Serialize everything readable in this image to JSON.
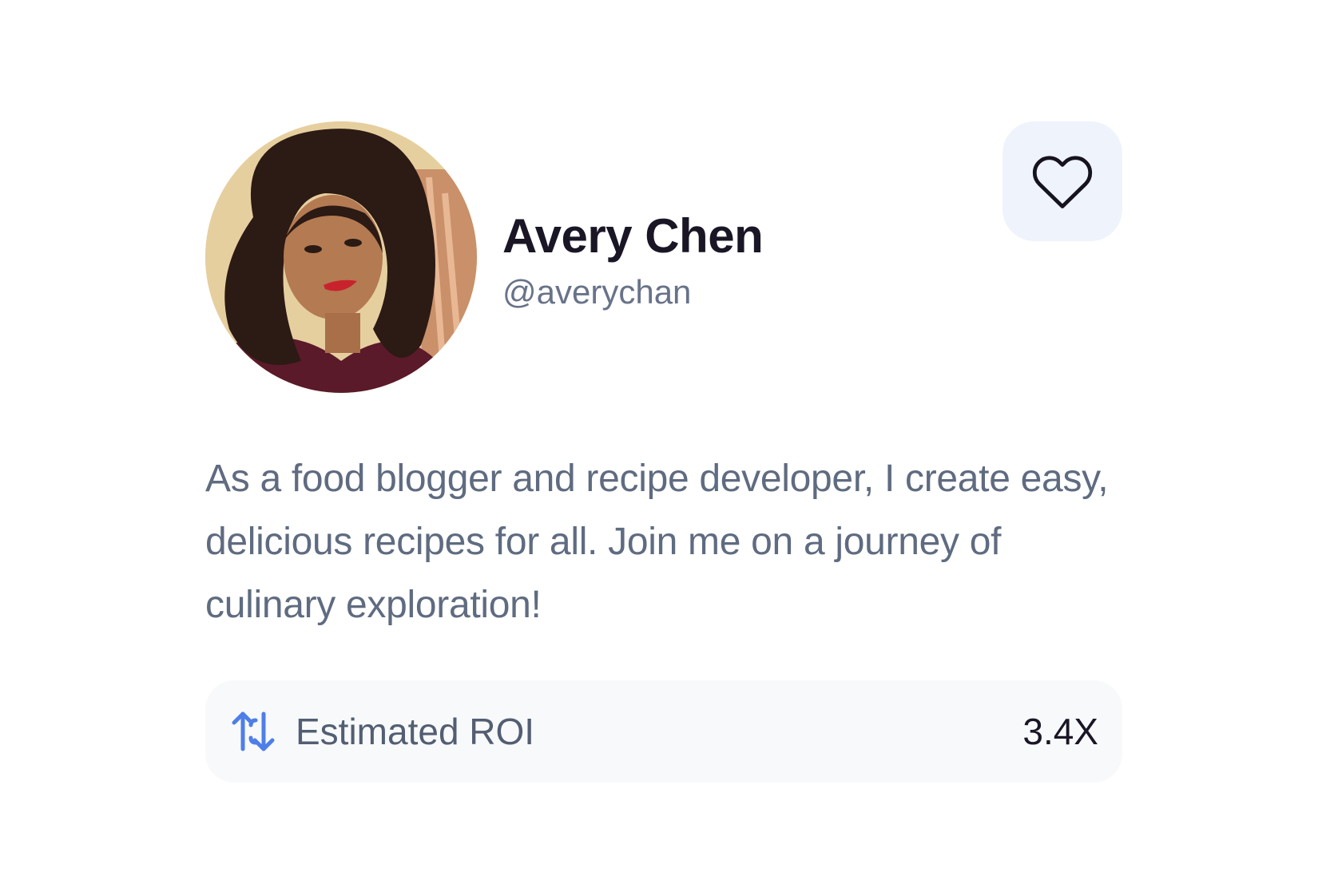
{
  "profile": {
    "name": "Avery Chen",
    "handle": "@averychan",
    "avatar": "portrait-photo",
    "bio": "As a food blogger and recipe developer, I create easy, delicious recipes for all. Join me on a journey of culinary exploration!"
  },
  "favorite": {
    "icon": "heart-outline-icon"
  },
  "stats": {
    "roi_label": "Estimated ROI",
    "roi_value": "3.4X",
    "roi_icon": "repeat-arrows-icon"
  },
  "colors": {
    "name": "#1a1626",
    "handle": "#687389",
    "bio": "#5f6b80",
    "favorite_bg": "#eef3fc",
    "roi_bg": "#f7f9fb",
    "roi_icon": "#4f7ee8"
  }
}
